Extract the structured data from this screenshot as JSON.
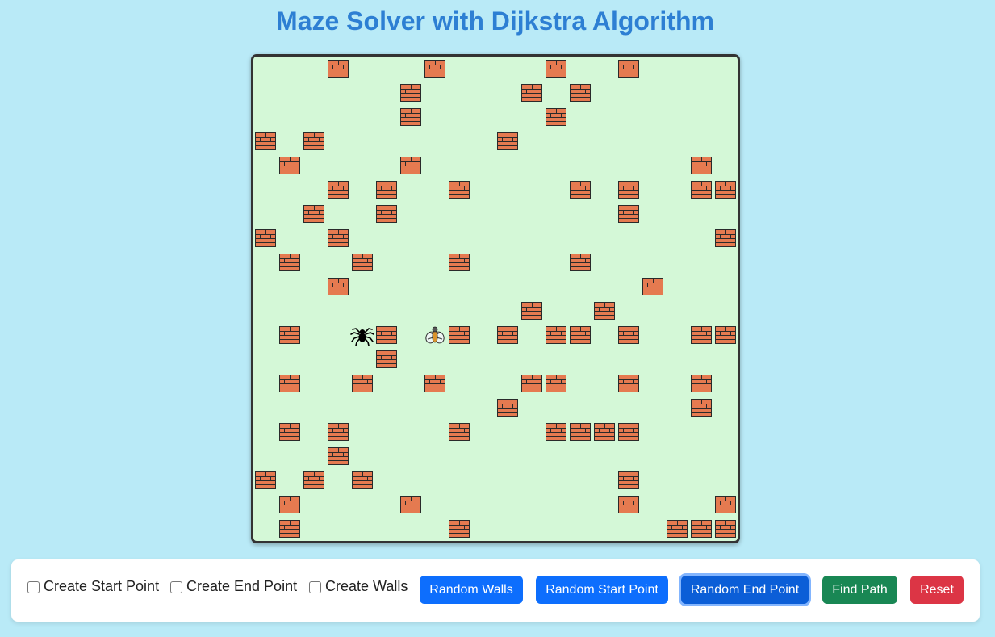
{
  "page": {
    "title": "Maze Solver with Dijkstra Algorithm"
  },
  "maze": {
    "grid_size": 20,
    "start": {
      "row": 11,
      "col": 4,
      "icon": "spider-icon"
    },
    "end": {
      "row": 11,
      "col": 7,
      "icon": "fly-icon"
    },
    "walls": [
      [
        0,
        3
      ],
      [
        0,
        7
      ],
      [
        0,
        12
      ],
      [
        0,
        15
      ],
      [
        1,
        6
      ],
      [
        1,
        11
      ],
      [
        1,
        13
      ],
      [
        2,
        6
      ],
      [
        2,
        12
      ],
      [
        3,
        0
      ],
      [
        3,
        2
      ],
      [
        3,
        10
      ],
      [
        4,
        1
      ],
      [
        4,
        6
      ],
      [
        4,
        18
      ],
      [
        5,
        3
      ],
      [
        5,
        5
      ],
      [
        5,
        8
      ],
      [
        5,
        13
      ],
      [
        5,
        15
      ],
      [
        5,
        18
      ],
      [
        5,
        19
      ],
      [
        6,
        2
      ],
      [
        6,
        5
      ],
      [
        6,
        15
      ],
      [
        7,
        0
      ],
      [
        7,
        3
      ],
      [
        7,
        19
      ],
      [
        8,
        1
      ],
      [
        8,
        4
      ],
      [
        8,
        8
      ],
      [
        8,
        13
      ],
      [
        9,
        3
      ],
      [
        9,
        16
      ],
      [
        10,
        11
      ],
      [
        10,
        14
      ],
      [
        11,
        1
      ],
      [
        11,
        5
      ],
      [
        11,
        8
      ],
      [
        11,
        10
      ],
      [
        11,
        12
      ],
      [
        11,
        13
      ],
      [
        11,
        15
      ],
      [
        11,
        18
      ],
      [
        11,
        19
      ],
      [
        12,
        5
      ],
      [
        13,
        1
      ],
      [
        13,
        4
      ],
      [
        13,
        7
      ],
      [
        13,
        11
      ],
      [
        13,
        12
      ],
      [
        13,
        15
      ],
      [
        13,
        18
      ],
      [
        14,
        10
      ],
      [
        14,
        18
      ],
      [
        15,
        1
      ],
      [
        15,
        3
      ],
      [
        15,
        8
      ],
      [
        15,
        12
      ],
      [
        15,
        13
      ],
      [
        15,
        14
      ],
      [
        15,
        15
      ],
      [
        16,
        3
      ],
      [
        17,
        0
      ],
      [
        17,
        2
      ],
      [
        17,
        4
      ],
      [
        17,
        15
      ],
      [
        18,
        1
      ],
      [
        18,
        6
      ],
      [
        18,
        15
      ],
      [
        18,
        19
      ],
      [
        19,
        1
      ],
      [
        19,
        8
      ],
      [
        19,
        17
      ],
      [
        19,
        18
      ],
      [
        19,
        19
      ]
    ]
  },
  "controls": {
    "create_start_label": "Create Start Point",
    "create_end_label": "Create End Point",
    "create_walls_label": "Create Walls",
    "create_start_checked": false,
    "create_end_checked": false,
    "create_walls_checked": false,
    "random_walls_label": "Random Walls",
    "random_start_label": "Random Start Point",
    "random_end_label": "Random End Point",
    "find_path_label": "Find Path",
    "reset_label": "Reset"
  },
  "colors": {
    "background": "#b9eaf7",
    "maze_bg": "#d4f8d7",
    "title": "#2d7fd3",
    "brick": "#e57a50",
    "primary": "#0d6efd",
    "success": "#198754",
    "danger": "#dc3545"
  }
}
